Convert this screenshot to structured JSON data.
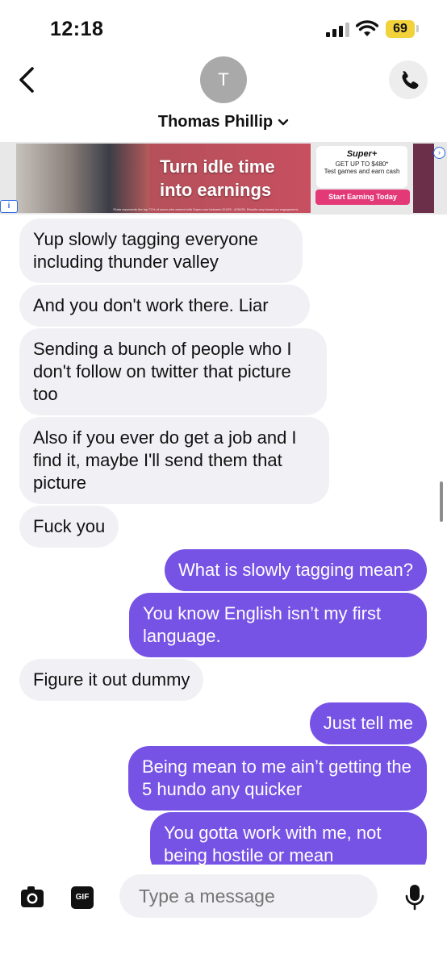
{
  "status_bar": {
    "time": "12:18",
    "battery": "69"
  },
  "header": {
    "avatar_initial": "T",
    "contact_name": "Thomas Phillip"
  },
  "ad": {
    "headline_line1": "Turn idle time",
    "headline_line2": "into earnings",
    "brand": "Super+",
    "offer": "GET UP TO $480*",
    "offer_sub": "Test games and earn cash",
    "cta": "Start Earning Today",
    "disclaimer": "*Data represents the top 71% of users who earned with Super.com between 5/1/25 - 6/30/25. Results vary based on engagement."
  },
  "messages": [
    {
      "dir": "in",
      "text": "Yup slowly tagging everyone including thunder valley"
    },
    {
      "dir": "in",
      "text": "And you don't work there. Liar"
    },
    {
      "dir": "in",
      "text": "Sending a bunch of people who I don't follow on twitter that picture too"
    },
    {
      "dir": "in",
      "text": "Also if you ever do get a job and I find it, maybe I'll send them that picture"
    },
    {
      "dir": "in",
      "text": "Fuck you"
    },
    {
      "dir": "out",
      "text": "What is slowly tagging mean?"
    },
    {
      "dir": "out",
      "text": "You know English isn’t my first language."
    },
    {
      "dir": "in",
      "text": "Figure it out dummy"
    },
    {
      "dir": "out",
      "text": "Just tell me"
    },
    {
      "dir": "out",
      "text": "Being mean to me ain’t getting the 5 hundo any quicker"
    },
    {
      "dir": "out",
      "text": "You gotta work with me, not being hostile or mean"
    }
  ],
  "composer": {
    "placeholder": "Type a message",
    "gif_label": "GIF"
  },
  "icons": {
    "back": "chevron-left-icon",
    "call": "phone-icon",
    "camera": "camera-icon",
    "mic": "microphone-icon",
    "dropdown": "chevron-down-icon"
  },
  "colors": {
    "outgoing_bubble": "#7652e5",
    "incoming_bubble": "#f1f1f5",
    "ad_cta": "#e33a77"
  }
}
